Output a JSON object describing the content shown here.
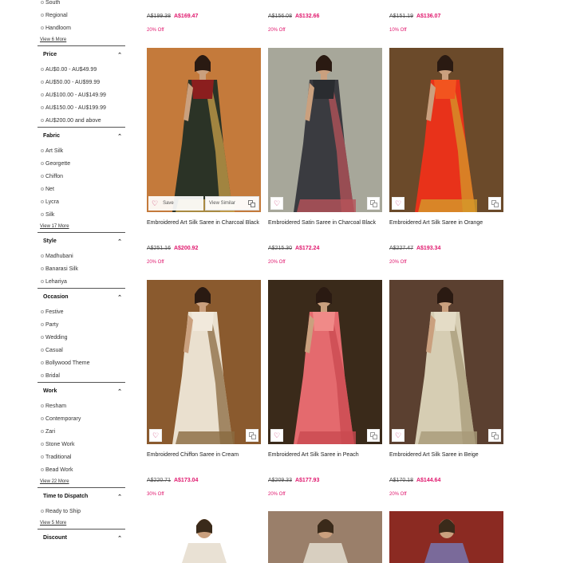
{
  "sidebar": {
    "top_options": [
      "South",
      "Regional",
      "Handloom"
    ],
    "top_more": "View 6 More",
    "sections": [
      {
        "title": "Price",
        "options": [
          "AU$0.00 - AU$49.99",
          "AU$50.00 - AU$99.99",
          "AU$100.00 - AU$149.99",
          "AU$150.00 - AU$199.99",
          "AU$200.00 and above"
        ],
        "more": ""
      },
      {
        "title": "Fabric",
        "options": [
          "Art Silk",
          "Georgette",
          "Chiffon",
          "Net",
          "Lycra",
          "Silk"
        ],
        "more": "View 17 More"
      },
      {
        "title": "Style",
        "options": [
          "Madhubani",
          "Banarasi Silk",
          "Lehariya"
        ],
        "more": ""
      },
      {
        "title": "Occasion",
        "options": [
          "Festive",
          "Party",
          "Wedding",
          "Casual",
          "Bollywood Theme",
          "Bridal"
        ],
        "more": ""
      },
      {
        "title": "Work",
        "options": [
          "Resham",
          "Contemporary",
          "Zari",
          "Stone Work",
          "Traditional",
          "Bead Work"
        ],
        "more": "View 22 More"
      },
      {
        "title": "Time to Dispatch",
        "options": [
          "Ready to Ship"
        ],
        "more": "View 5 More"
      },
      {
        "title": "Discount",
        "options": [],
        "more": ""
      }
    ]
  },
  "top_prices": [
    {
      "old": "A$199.38",
      "new": "A$169.47",
      "discount": "20% Off"
    },
    {
      "old": "A$156.08",
      "new": "A$132.66",
      "discount": "20% Off"
    },
    {
      "old": "A$151.19",
      "new": "A$136.07",
      "discount": "10% Off"
    }
  ],
  "products": [
    {
      "name": "Embroidered Art Silk Saree in Charcoal Black",
      "old": "A$251.16",
      "new": "A$200.92",
      "discount": "20% Off",
      "colors": [
        "#2b3326",
        "#c9a04a",
        "#8b1e1e"
      ],
      "bg": "#c47a3b"
    },
    {
      "name": "Embroidered Satin Saree in Charcoal Black",
      "old": "A$215.30",
      "new": "A$172.24",
      "discount": "20% Off",
      "colors": [
        "#3a3b40",
        "#b8545a",
        "#2a2c30"
      ],
      "bg": "#a7a79a"
    },
    {
      "name": "Embroidered Art Silk Saree in Orange",
      "old": "A$227.47",
      "new": "A$193.34",
      "discount": "20% Off",
      "colors": [
        "#e8321a",
        "#d49a2a",
        "#f2541f"
      ],
      "bg": "#6b4a2a"
    },
    {
      "name": "Embroidered Chiffon Saree in Cream",
      "old": "A$220.71",
      "new": "A$173.04",
      "discount": "30% Off",
      "colors": [
        "#eae0cf",
        "#8a6a40",
        "#f1e9dc"
      ],
      "bg": "#8a5a2e"
    },
    {
      "name": "Embroidered Art Silk Saree in Peach",
      "old": "A$209.33",
      "new": "A$177.93",
      "discount": "20% Off",
      "colors": [
        "#e46a6e",
        "#c94a50",
        "#f08a88"
      ],
      "bg": "#3a2a1a"
    },
    {
      "name": "Embroidered Art Silk Saree in Beige",
      "old": "A$170.18",
      "new": "A$144.64",
      "discount": "20% Off",
      "colors": [
        "#d6cdb3",
        "#a79a78",
        "#e4dcc6"
      ],
      "bg": "#5b4030"
    }
  ],
  "bottom_row": [
    {
      "bg": "#ffffff",
      "accent": "#e9e1d4"
    },
    {
      "bg": "#9a7f6a",
      "accent": "#d8cfc0"
    },
    {
      "bg": "#8b2a22",
      "accent": "#7a6a9a"
    }
  ],
  "labels": {
    "save": "Save",
    "view_similar": "View Similar"
  },
  "colors": {
    "accent": "#e0176d",
    "heart": "#c2185b"
  }
}
